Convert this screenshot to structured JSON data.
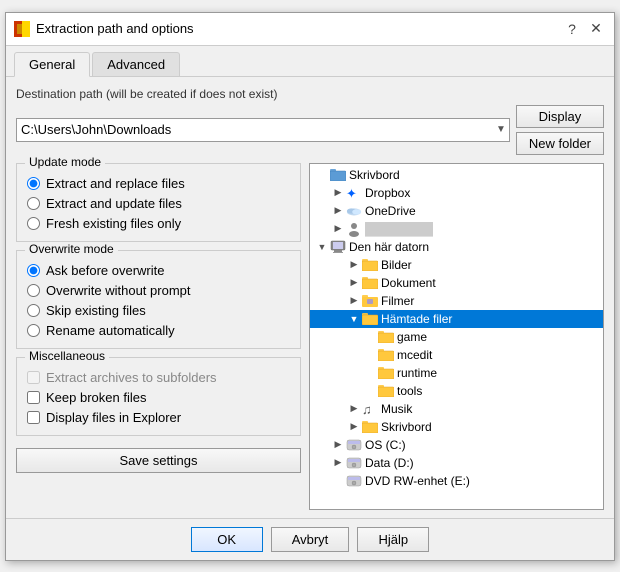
{
  "dialog": {
    "title": "Extraction path and options",
    "help_label": "?",
    "close_label": "✕"
  },
  "tabs": [
    {
      "id": "general",
      "label": "General",
      "active": true
    },
    {
      "id": "advanced",
      "label": "Advanced",
      "active": false
    }
  ],
  "destination": {
    "label": "Destination path (will be created if does not exist)",
    "path": "C:\\Users\\John\\Downloads",
    "display_btn": "Display",
    "new_folder_btn": "New folder"
  },
  "update_mode": {
    "title": "Update mode",
    "options": [
      {
        "id": "extract_replace",
        "label": "Extract and replace files",
        "checked": true
      },
      {
        "id": "extract_update",
        "label": "Extract and update files",
        "checked": false
      },
      {
        "id": "fresh_existing",
        "label": "Fresh existing files only",
        "checked": false
      }
    ]
  },
  "overwrite_mode": {
    "title": "Overwrite mode",
    "options": [
      {
        "id": "ask_before",
        "label": "Ask before overwrite",
        "checked": true
      },
      {
        "id": "overwrite_no_prompt",
        "label": "Overwrite without prompt",
        "checked": false
      },
      {
        "id": "skip_existing",
        "label": "Skip existing files",
        "checked": false
      },
      {
        "id": "rename_auto",
        "label": "Rename automatically",
        "checked": false
      }
    ]
  },
  "miscellaneous": {
    "title": "Miscellaneous",
    "options": [
      {
        "id": "extract_subfolders",
        "label": "Extract archives to subfolders",
        "checked": false,
        "disabled": true
      },
      {
        "id": "keep_broken",
        "label": "Keep broken files",
        "checked": false
      },
      {
        "id": "display_explorer",
        "label": "Display files in Explorer",
        "checked": false
      }
    ]
  },
  "save_btn": "Save settings",
  "tree": {
    "items": [
      {
        "id": "skrivbord",
        "label": "Skrivbord",
        "indent": 0,
        "expanded": false,
        "icon": "folder-blue",
        "hasExpander": false,
        "selected": false
      },
      {
        "id": "dropbox",
        "label": "Dropbox",
        "indent": 1,
        "expanded": false,
        "icon": "dropbox",
        "hasExpander": true,
        "selected": false
      },
      {
        "id": "onedrive",
        "label": "OneDrive",
        "indent": 1,
        "expanded": false,
        "icon": "onedrive",
        "hasExpander": true,
        "selected": false
      },
      {
        "id": "user_blurred",
        "label": "████████",
        "indent": 1,
        "expanded": false,
        "icon": "person",
        "hasExpander": true,
        "selected": false
      },
      {
        "id": "den_har",
        "label": "Den här datorn",
        "indent": 0,
        "expanded": true,
        "icon": "computer",
        "hasExpander": true,
        "selected": false
      },
      {
        "id": "bilder",
        "label": "Bilder",
        "indent": 2,
        "expanded": false,
        "icon": "folder-yellow",
        "hasExpander": true,
        "selected": false
      },
      {
        "id": "dokument",
        "label": "Dokument",
        "indent": 2,
        "expanded": false,
        "icon": "folder-yellow",
        "hasExpander": true,
        "selected": false
      },
      {
        "id": "filmer",
        "label": "Filmer",
        "indent": 2,
        "expanded": false,
        "icon": "folder-special",
        "hasExpander": true,
        "selected": false
      },
      {
        "id": "hamtade",
        "label": "Hämtade filer",
        "indent": 2,
        "expanded": true,
        "icon": "folder-yellow",
        "hasExpander": true,
        "selected": true
      },
      {
        "id": "game",
        "label": "game",
        "indent": 3,
        "expanded": false,
        "icon": "folder-yellow",
        "hasExpander": false,
        "selected": false
      },
      {
        "id": "mcedit",
        "label": "mcedit",
        "indent": 3,
        "expanded": false,
        "icon": "folder-yellow",
        "hasExpander": false,
        "selected": false
      },
      {
        "id": "runtime",
        "label": "runtime",
        "indent": 3,
        "expanded": false,
        "icon": "folder-yellow",
        "hasExpander": false,
        "selected": false
      },
      {
        "id": "tools",
        "label": "tools",
        "indent": 3,
        "expanded": false,
        "icon": "folder-yellow",
        "hasExpander": false,
        "selected": false
      },
      {
        "id": "musik",
        "label": "Musik",
        "indent": 2,
        "expanded": false,
        "icon": "music",
        "hasExpander": true,
        "selected": false
      },
      {
        "id": "skrivbord2",
        "label": "Skrivbord",
        "indent": 2,
        "expanded": false,
        "icon": "folder-yellow",
        "hasExpander": true,
        "selected": false
      },
      {
        "id": "osc",
        "label": "OS (C:)",
        "indent": 1,
        "expanded": false,
        "icon": "disk",
        "hasExpander": true,
        "selected": false
      },
      {
        "id": "datad",
        "label": "Data (D:)",
        "indent": 1,
        "expanded": false,
        "icon": "disk",
        "hasExpander": true,
        "selected": false
      },
      {
        "id": "dvd",
        "label": "DVD RW-enhet (E:)",
        "indent": 1,
        "expanded": false,
        "icon": "disk",
        "hasExpander": false,
        "selected": false
      }
    ]
  },
  "footer": {
    "ok": "OK",
    "cancel": "Avbryt",
    "help": "Hjälp"
  }
}
